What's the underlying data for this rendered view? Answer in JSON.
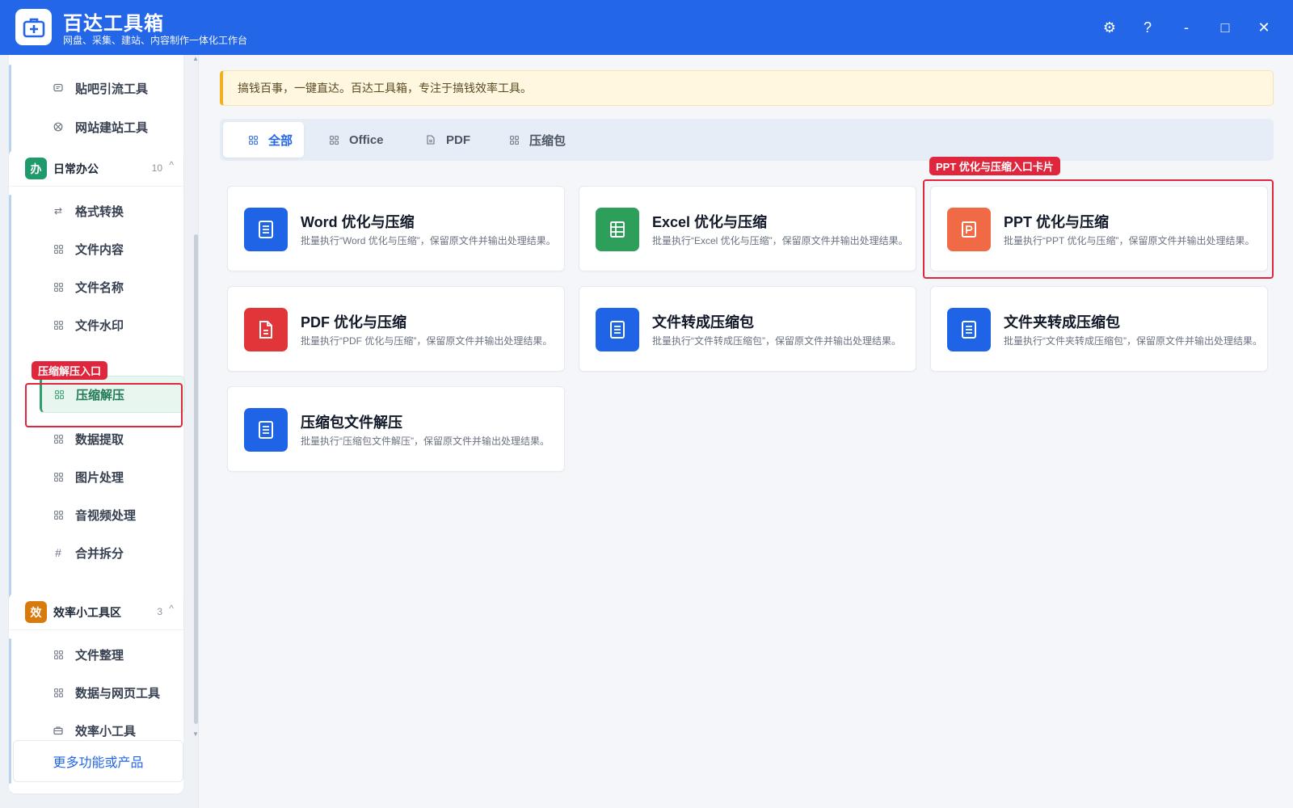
{
  "app": {
    "title": "百达工具箱",
    "subtitle": "网盘、采集、建站、内容制作一体化工作台"
  },
  "window_controls": {
    "settings": "⚙",
    "help": "?",
    "minimize": "-",
    "maximize": "□",
    "close": "✕"
  },
  "sidebar": {
    "top_items": [
      {
        "label": "贴吧引流工具",
        "icon": "comment-icon"
      },
      {
        "label": "网站建站工具",
        "icon": "globe-icon"
      }
    ],
    "groups": [
      {
        "badge": "办",
        "badge_color": "#1f9a6a",
        "title": "日常办公",
        "count": "10",
        "caret": "^",
        "items": [
          {
            "label": "格式转换",
            "icon": "swap-icon"
          },
          {
            "label": "文件内容",
            "icon": "grid-icon"
          },
          {
            "label": "文件名称",
            "icon": "grid-icon"
          },
          {
            "label": "文件水印",
            "icon": "grid-icon"
          },
          {
            "label": "压缩解压",
            "icon": "grid-icon",
            "active": true
          },
          {
            "label": "数据提取",
            "icon": "grid-icon"
          },
          {
            "label": "图片处理",
            "icon": "grid-icon"
          },
          {
            "label": "音视频处理",
            "icon": "grid-icon"
          },
          {
            "label": "合并拆分",
            "icon": "hash-icon"
          }
        ]
      },
      {
        "badge": "效",
        "badge_color": "#d97a0c",
        "title": "效率小工具区",
        "count": "3",
        "caret": "^",
        "items": [
          {
            "label": "文件整理",
            "icon": "grid-icon"
          },
          {
            "label": "数据与网页工具",
            "icon": "grid-icon"
          },
          {
            "label": "效率小工具",
            "icon": "toolbox-icon"
          }
        ]
      }
    ],
    "more_label": "更多功能或产品"
  },
  "annotations": {
    "sidebar_tag": "压缩解压入口",
    "card_tag": "PPT 优化与压缩入口卡片"
  },
  "notice": "搞钱百事，一键直达。百达工具箱，专注于搞钱效率工具。",
  "tabs": [
    {
      "label": "全部",
      "icon": "grid-icon",
      "active": true
    },
    {
      "label": "Office",
      "icon": "grid-icon"
    },
    {
      "label": "PDF",
      "icon": "document-icon"
    },
    {
      "label": "压缩包",
      "icon": "grid-icon"
    }
  ],
  "cards": [
    {
      "title": "Word 优化与压缩",
      "desc": "批量执行“Word 优化与压缩”，保留原文件并输出处理结果。",
      "icon": "document-icon",
      "color": "#1f63e6"
    },
    {
      "title": "Excel 优化与压缩",
      "desc": "批量执行“Excel 优化与压缩”，保留原文件并输出处理结果。",
      "icon": "spreadsheet-icon",
      "color": "#2e9e5b"
    },
    {
      "title": "PPT 优化与压缩",
      "desc": "批量执行“PPT 优化与压缩”，保留原文件并输出处理结果。",
      "icon": "presentation-icon",
      "color": "#ef6a45"
    },
    {
      "title": "PDF 优化与压缩",
      "desc": "批量执行“PDF 优化与压缩”，保留原文件并输出处理结果。",
      "icon": "pdf-icon",
      "color": "#e0363a"
    },
    {
      "title": "文件转成压缩包",
      "desc": "批量执行“文件转成压缩包”，保留原文件并输出处理结果。",
      "icon": "document-icon",
      "color": "#1f63e6"
    },
    {
      "title": "文件夹转成压缩包",
      "desc": "批量执行“文件夹转成压缩包”，保留原文件并输出处理结果。",
      "icon": "document-icon",
      "color": "#1f63e6"
    },
    {
      "title": "压缩包文件解压",
      "desc": "批量执行“压缩包文件解压”，保留原文件并输出处理结果。",
      "icon": "document-icon",
      "color": "#1f63e6"
    }
  ]
}
